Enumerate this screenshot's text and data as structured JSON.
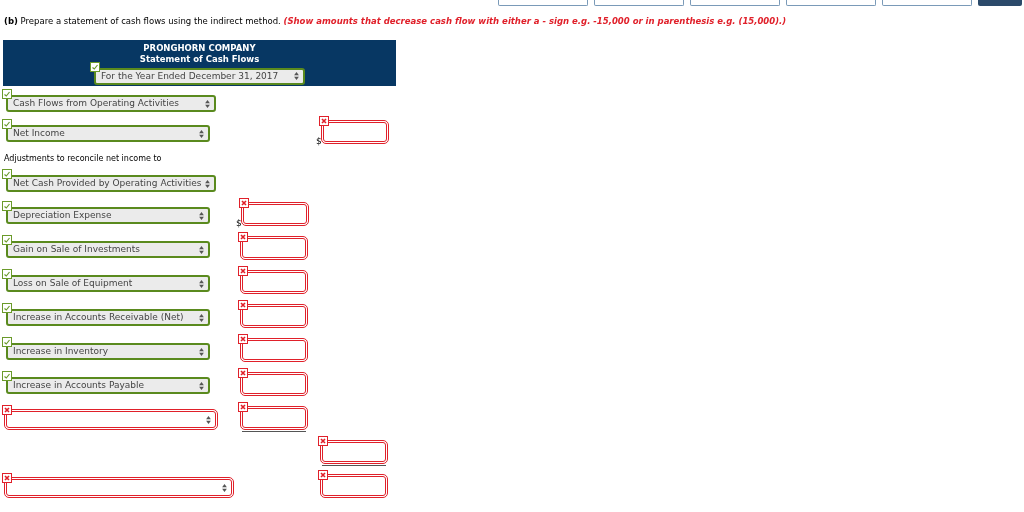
{
  "toolbar": {
    "buttons": [
      {
        "kind": "light"
      },
      {
        "kind": "light"
      },
      {
        "kind": "light"
      },
      {
        "kind": "light"
      },
      {
        "kind": "light"
      },
      {
        "kind": "dark"
      }
    ]
  },
  "instruction": {
    "part": "(b)",
    "text": "Prepare a statement of cash flows using the indirect method.",
    "note": "(Show amounts that decrease cash flow with either a - sign e.g. -15,000 or in parenthesis e.g. (15,000).)"
  },
  "header": {
    "company": "PRONGHORN COMPANY",
    "title": "Statement of Cash Flows",
    "period": {
      "value": "For the Year Ended December 31, 2017",
      "correct": true
    }
  },
  "lines": [
    {
      "kind": "heading",
      "value": "Cash Flows from Operating Activities",
      "correct": true
    },
    {
      "kind": "item",
      "value": "Net Income",
      "correct": true,
      "amount": {
        "kind": "total",
        "correct": false,
        "dollar": "$"
      }
    },
    {
      "kind": "text",
      "value": "Adjustments to reconcile net income to"
    },
    {
      "kind": "heading",
      "value": "Net Cash Provided by Operating Activities",
      "correct": true
    },
    {
      "kind": "item",
      "value": "Depreciation Expense",
      "correct": true,
      "amount": {
        "kind": "item",
        "correct": false,
        "dollar": "$"
      }
    },
    {
      "kind": "item",
      "value": "Gain on Sale of Investments",
      "correct": true,
      "amount": {
        "kind": "item",
        "correct": false
      }
    },
    {
      "kind": "item",
      "value": "Loss on Sale of Equipment",
      "correct": true,
      "amount": {
        "kind": "item",
        "correct": false
      }
    },
    {
      "kind": "item",
      "value": "Increase in Accounts Receivable (Net)",
      "correct": true,
      "amount": {
        "kind": "item",
        "correct": false
      }
    },
    {
      "kind": "item",
      "value": "Increase in Inventory",
      "correct": true,
      "amount": {
        "kind": "item",
        "correct": false
      }
    },
    {
      "kind": "item",
      "value": "Increase in Accounts Payable",
      "correct": true,
      "amount": {
        "kind": "item",
        "correct": false
      }
    },
    {
      "kind": "heading",
      "correct": false,
      "amount": {
        "kind": "item",
        "correct": false,
        "underline": true
      }
    },
    {
      "kind": "blank",
      "amount": {
        "kind": "total",
        "correct": false,
        "underline": true
      }
    },
    {
      "kind": "summary",
      "correct": false,
      "amount": {
        "kind": "total",
        "correct": false
      }
    }
  ]
}
